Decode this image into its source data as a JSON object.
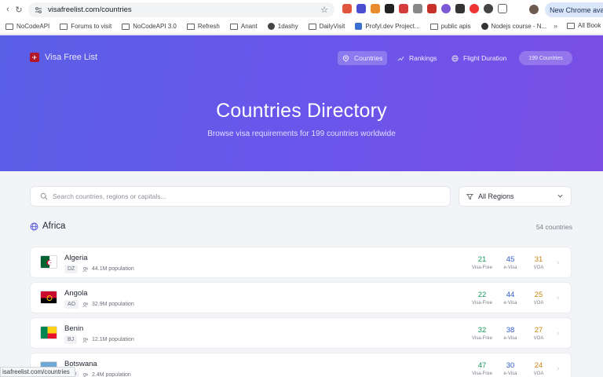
{
  "browser": {
    "url": "visafreelist.com/countries",
    "new_chrome_label": "New Chrome availa",
    "status_url": "isafreelist.com/countries"
  },
  "bookmarks": {
    "items": [
      "NoCodeAPI",
      "Forums to visit",
      "NoCodeAPI 3.0",
      "Refresh",
      "Anant",
      "1dashy",
      "DailyVisit",
      "Profyl.dev Project...",
      "public apis",
      "Nodejs course - N..."
    ],
    "more": "»",
    "all": "All Book"
  },
  "site": {
    "logo_text": "Visa Free List",
    "nav": {
      "countries": "Countries",
      "rankings": "Rankings",
      "flight_duration": "Flight Duration",
      "count_pill": "199 Countries"
    },
    "title": "Countries Directory",
    "subtitle": "Browse visa requirements for 199 countries worldwide"
  },
  "filters": {
    "search_placeholder": "Search countries, regions or capitals...",
    "region_value": "All Regions"
  },
  "section": {
    "name": "Africa",
    "count_label": "54 countries"
  },
  "stat_labels": {
    "visa_free": "Visa-Free",
    "evisa": "e-Visa",
    "voa": "VOA"
  },
  "countries": [
    {
      "name": "Algeria",
      "code": "DZ",
      "population": "44.1M population",
      "visa_free": "21",
      "evisa": "45",
      "voa": "31"
    },
    {
      "name": "Angola",
      "code": "AO",
      "population": "32.9M population",
      "visa_free": "22",
      "evisa": "44",
      "voa": "25"
    },
    {
      "name": "Benin",
      "code": "BJ",
      "population": "12.1M population",
      "visa_free": "32",
      "evisa": "38",
      "voa": "27"
    },
    {
      "name": "Botswana",
      "code": "BW",
      "population": "2.4M population",
      "visa_free": "47",
      "evisa": "30",
      "voa": "24"
    }
  ]
}
